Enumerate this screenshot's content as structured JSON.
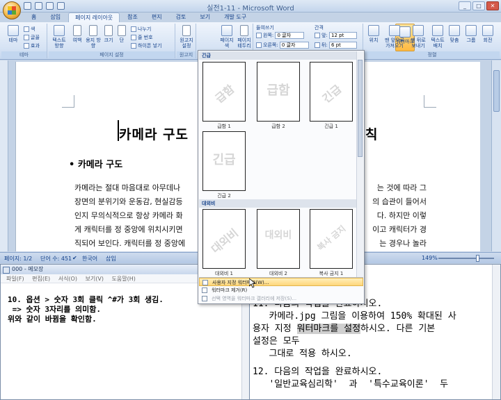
{
  "window": {
    "title": "실전1-11 - Microsoft Word"
  },
  "tabs": [
    "홈",
    "삽입",
    "페이지 레이아웃",
    "참조",
    "편지",
    "검토",
    "보기",
    "개발 도구"
  ],
  "ribbon": {
    "theme": {
      "big": "테마",
      "color": "색",
      "font": "글꼴",
      "effect": "효과",
      "group": "테마"
    },
    "page_setup": {
      "text_dir": "텍스트 방향",
      "margins": "여백",
      "orientation": "용지 방향",
      "size": "크기",
      "columns": "단",
      "breaks": "나누기",
      "line_numbers": "줄 번호",
      "hyphenation": "하이픈 넣기",
      "group": "페이지 설정"
    },
    "paper": {
      "label": "원고지 설정",
      "group": "원고지"
    },
    "background": {
      "watermark": "워터마크",
      "page_color": "페이지 색",
      "page_border": "페이지 테두리"
    },
    "paragraph": {
      "indent_label": "들여쓰기",
      "left_label": "왼쪽:",
      "left_value": "0 글자",
      "right_label": "오른쪽:",
      "right_value": "0 글자",
      "spacing_label": "간격",
      "before_label": "앞:",
      "before_value": "12 pt",
      "after_label": "뒤:",
      "after_value": "6 pt"
    },
    "arrange": {
      "position": "위치",
      "bring_front": "맨 앞으로 가져오기",
      "send_back": "맨 뒤로 보내기",
      "text_wrap": "텍스트 배치",
      "align": "맞춤",
      "group_btn": "그룹",
      "rotate": "회전",
      "group": "정렬"
    }
  },
  "document": {
    "title_start": "카메라 구도",
    "title_end": "칙",
    "heading": "카메라 구도",
    "body_lines": [
      "카메라는 절대 마음대로 아무데나",
      "장면의 분위기와 운동감, 현실감등",
      "인지 무의식적으로 항상 카메라 화",
      "게 캐릭터를 정 중앙에 위치시키면",
      "직되어 보인다. 캐릭터를 정 중앙에"
    ],
    "body_right_lines": [
      "는 것에 따라 그",
      "의 습관이 들어서",
      "다. 하지만 이렇",
      "이고 캐릭터가 경",
      "는 경우나 놀라"
    ]
  },
  "status": {
    "page": "페이지: 1/2",
    "words": "단어 수: 451",
    "language": "한국어",
    "insert_mode": "삽입",
    "zoom": "149%"
  },
  "gallery": {
    "section_urgent": "긴급",
    "section_confidential": "대외비",
    "items_row1": [
      {
        "text": "급함",
        "label": "급함 1"
      },
      {
        "text": "급함",
        "label": "급함 2"
      },
      {
        "text": "긴급",
        "label": "긴급 1"
      }
    ],
    "item_row2": {
      "text": "긴급",
      "label": "긴급 2"
    },
    "items_row3": [
      {
        "text": "대외비",
        "label": "대외비 1"
      },
      {
        "text": "대외비",
        "label": "대외비 2"
      },
      {
        "text": "복사 금지",
        "label": "복사 금지 1"
      }
    ],
    "menu": {
      "custom": "사용자 지정 워터마크(W)...",
      "remove": "워터마크 제거(R)",
      "save_selection": "선택 영역을 워터마크 갤러리에 저장(S)..."
    }
  },
  "notepad": {
    "title": "000 - 메모장",
    "menu": [
      "파일(F)",
      "편집(E)",
      "서식(O)",
      "보기(V)",
      "도움말(H)"
    ],
    "lines": [
      "10. 옵션 > 숫자 3회 클릭 ^#가 3회 생김.",
      " => 숫자 3자리를 의미함.",
      "위와 같이 바뀜을 확인함."
    ]
  },
  "doc2": {
    "line1": "11. 다음의 작업을 완료하시오.",
    "line2": "   카메라.jpg 그림을 이용하여 150% 확대된 사",
    "line3_a": "용자 지정 ",
    "line3_hl": "워터마크를 설정",
    "line3_b": "하시오. 다른 기본",
    "line4": "설정은 모두",
    "line5": "   그대로 적용 하시오.",
    "line6": "12. 다음의 작업을 완료하시오.",
    "line7": "   '일반교육심리학'  과  '특수교육이론'  두"
  }
}
